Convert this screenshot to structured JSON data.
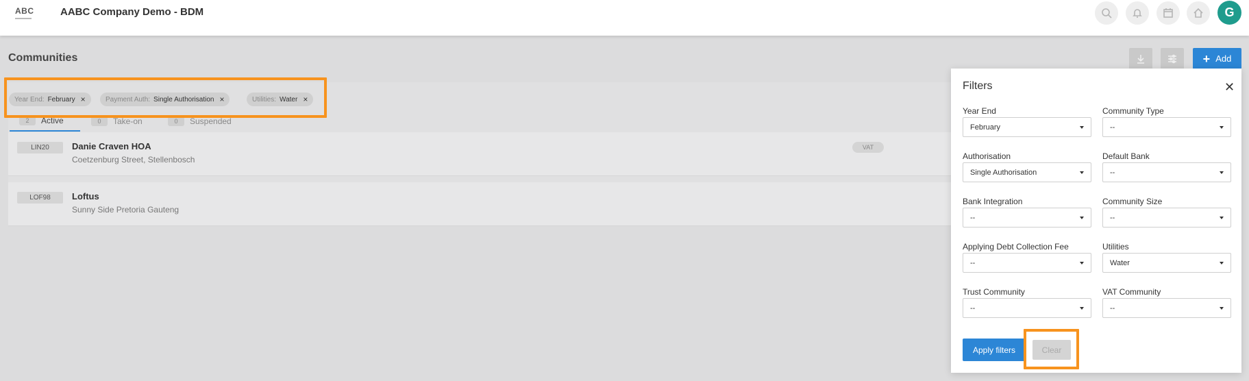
{
  "header": {
    "logo": "ABC",
    "app_title": "AABC Company Demo - BDM",
    "icons": [
      "search-icon",
      "bell-icon",
      "calendar-icon",
      "home-icon"
    ],
    "avatar_letter": "G",
    "avatar_color": "#1f9c8d"
  },
  "page": {
    "title": "Communities",
    "add_label": "Add",
    "accent_color": "#2c86d6"
  },
  "active_filters": [
    {
      "key": "Year End:",
      "value": "February"
    },
    {
      "key": "Payment Auth:",
      "value": "Single Authorisation"
    },
    {
      "key": "Utilities:",
      "value": "Water"
    }
  ],
  "tabs": [
    {
      "count": "2",
      "label": "Active"
    },
    {
      "count": "0",
      "label": "Take-on"
    },
    {
      "count": "0",
      "label": "Suspended"
    }
  ],
  "communities": [
    {
      "code": "LIN20",
      "name": "Danie Craven HOA",
      "address": "Coetzenburg Street, Stellenbosch",
      "badge": "VAT"
    },
    {
      "code": "LOF98",
      "name": "Loftus",
      "address": "Sunny Side Pretoria Gauteng",
      "badge": ""
    }
  ],
  "filters_panel": {
    "title": "Filters",
    "fields": [
      {
        "label": "Year End",
        "value": "February"
      },
      {
        "label": "Community Type",
        "value": "--"
      },
      {
        "label": "Authorisation",
        "value": "Single Authorisation"
      },
      {
        "label": "Default Bank",
        "value": "--"
      },
      {
        "label": "Bank Integration",
        "value": "--"
      },
      {
        "label": "Community Size",
        "value": "--"
      },
      {
        "label": "Applying Debt Collection Fee",
        "value": "--"
      },
      {
        "label": "Utilities",
        "value": "Water"
      },
      {
        "label": "Trust Community",
        "value": "--"
      },
      {
        "label": "VAT Community",
        "value": "--"
      }
    ],
    "apply_label": "Apply filters",
    "clear_label": "Clear"
  },
  "highlight_color": "#f7931e"
}
